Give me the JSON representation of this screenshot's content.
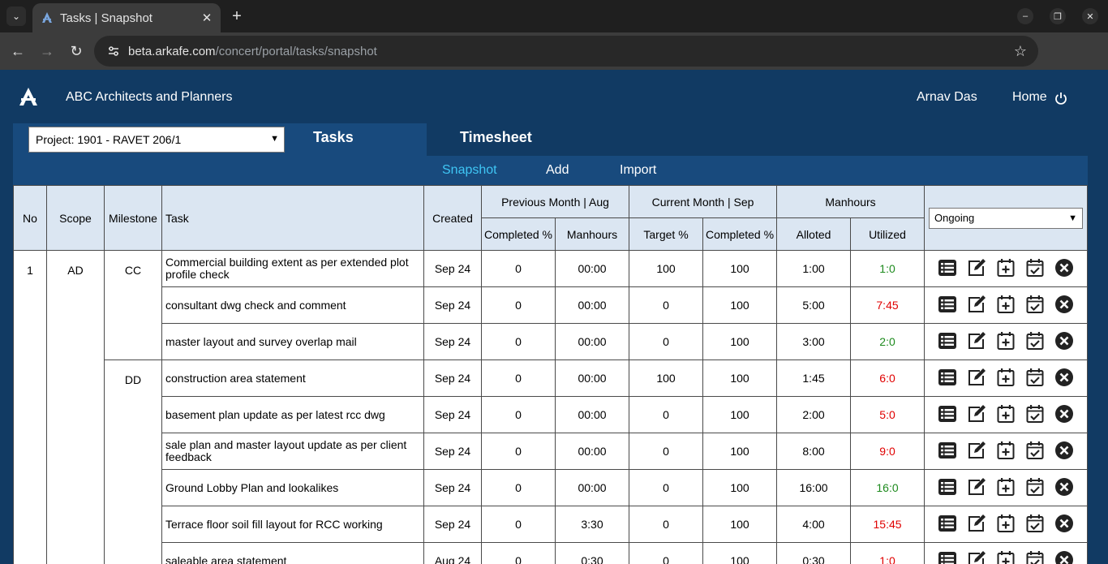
{
  "browser": {
    "tab_title": "Tasks | Snapshot",
    "url_domain": "beta.arkafe.com",
    "url_path": "/concert/portal/tasks/snapshot"
  },
  "header": {
    "org_name": "ABC Architects and Planners",
    "user_name": "Arnav Das",
    "home_label": "Home"
  },
  "project": {
    "selected": "Project: 1901 - RAVET 206/1"
  },
  "main_tabs": {
    "tasks": "Tasks",
    "timesheet": "Timesheet"
  },
  "sub_nav": {
    "snapshot": "Snapshot",
    "add": "Add",
    "import": "Import"
  },
  "table": {
    "headers": {
      "no": "No",
      "scope": "Scope",
      "milestone": "Milestone",
      "task": "Task",
      "created": "Created",
      "prev_month": "Previous Month | Aug",
      "curr_month": "Current Month | Sep",
      "manhours": "Manhours",
      "completed_pct": "Completed %",
      "manhours_sub": "Manhours",
      "target_pct": "Target %",
      "completed_pct2": "Completed %",
      "alloted": "Alloted",
      "utilized": "Utilized"
    },
    "status_filter": "Ongoing",
    "no_value": "1",
    "scope_value": "AD",
    "milestones": [
      "CC",
      "DD"
    ],
    "rows": [
      {
        "task": "Commercial building extent as per extended plot profile check",
        "created": "Sep 24",
        "prev_completed": "0",
        "prev_manhours": "00:00",
        "target": "100",
        "completed": "100",
        "alloted": "1:00",
        "utilized": "1:0",
        "utilized_color": "green"
      },
      {
        "task": "consultant dwg check and comment",
        "created": "Sep 24",
        "prev_completed": "0",
        "prev_manhours": "00:00",
        "target": "0",
        "completed": "100",
        "alloted": "5:00",
        "utilized": "7:45",
        "utilized_color": "red"
      },
      {
        "task": "master layout and survey overlap mail",
        "created": "Sep 24",
        "prev_completed": "0",
        "prev_manhours": "00:00",
        "target": "0",
        "completed": "100",
        "alloted": "3:00",
        "utilized": "2:0",
        "utilized_color": "green"
      },
      {
        "task": "construction area statement",
        "created": "Sep 24",
        "prev_completed": "0",
        "prev_manhours": "00:00",
        "target": "100",
        "completed": "100",
        "alloted": "1:45",
        "utilized": "6:0",
        "utilized_color": "red"
      },
      {
        "task": "basement plan update as per latest rcc dwg",
        "created": "Sep 24",
        "prev_completed": "0",
        "prev_manhours": "00:00",
        "target": "0",
        "completed": "100",
        "alloted": "2:00",
        "utilized": "5:0",
        "utilized_color": "red"
      },
      {
        "task": "sale plan and master layout update as per client feedback",
        "created": "Sep 24",
        "prev_completed": "0",
        "prev_manhours": "00:00",
        "target": "0",
        "completed": "100",
        "alloted": "8:00",
        "utilized": "9:0",
        "utilized_color": "red"
      },
      {
        "task": "Ground Lobby Plan and lookalikes",
        "created": "Sep 24",
        "prev_completed": "0",
        "prev_manhours": "00:00",
        "target": "0",
        "completed": "100",
        "alloted": "16:00",
        "utilized": "16:0",
        "utilized_color": "green"
      },
      {
        "task": "Terrace floor soil fill layout for RCC working",
        "created": "Sep 24",
        "prev_completed": "0",
        "prev_manhours": "3:30",
        "target": "0",
        "completed": "100",
        "alloted": "4:00",
        "utilized": "15:45",
        "utilized_color": "red"
      },
      {
        "task": "saleable area statement",
        "created": "Aug 24",
        "prev_completed": "0",
        "prev_manhours": "0:30",
        "target": "0",
        "completed": "100",
        "alloted": "0:30",
        "utilized": "1:0",
        "utilized_color": "red"
      }
    ],
    "row_actions": [
      "list-icon",
      "edit-icon",
      "calendar-add-icon",
      "calendar-check-icon",
      "close-circle-icon"
    ]
  },
  "colors": {
    "app_bg": "#113a63",
    "nav_bg": "#184a7d",
    "active_link": "#3fc6f5",
    "header_cell": "#dbe6f2",
    "green": "#1d8a1d",
    "red": "#e00000"
  }
}
